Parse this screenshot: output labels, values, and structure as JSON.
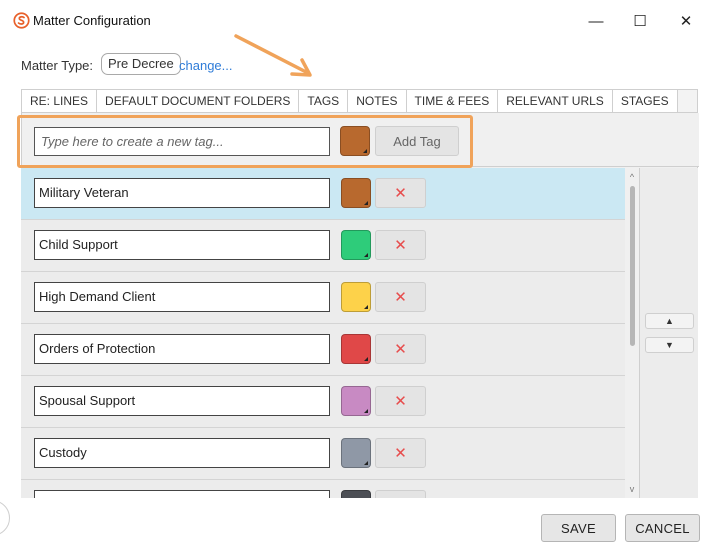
{
  "window": {
    "title": "Matter Configuration",
    "min_glyph": "—",
    "max_glyph": "☐",
    "close_glyph": "✕"
  },
  "matter_type": {
    "label": "Matter Type:",
    "value": "Pre Decree",
    "change_link": "change..."
  },
  "tabs": [
    {
      "label": "RE: LINES"
    },
    {
      "label": "DEFAULT DOCUMENT FOLDERS"
    },
    {
      "label": "TAGS",
      "active": true
    },
    {
      "label": "NOTES"
    },
    {
      "label": "TIME & FEES"
    },
    {
      "label": "RELEVANT URLS"
    },
    {
      "label": "STAGES"
    }
  ],
  "new_tag": {
    "placeholder": "Type here to create a new tag...",
    "color": "#b8692e",
    "add_label": "Add Tag"
  },
  "tags": [
    {
      "name": "Military Veteran",
      "color": "#b8692e",
      "selected": true
    },
    {
      "name": "Child Support",
      "color": "#2ecc7a"
    },
    {
      "name": "High Demand Client",
      "color": "#fdd24a"
    },
    {
      "name": "Orders of Protection",
      "color": "#e04848"
    },
    {
      "name": "Spousal Support",
      "color": "#c88ac3"
    },
    {
      "name": "Custody",
      "color": "#8f98a6"
    },
    {
      "name": "",
      "color": "#4c4f55"
    }
  ],
  "delete_glyph": "✕",
  "reorder": {
    "up": "▲",
    "down": "▼"
  },
  "scroll": {
    "up": "^",
    "down": "v"
  },
  "footer": {
    "save_label": "SAVE",
    "cancel_label": "CANCEL"
  },
  "colors": {
    "highlight": "#f0a35a",
    "link": "#2f7cd8",
    "selected_row": "#cbe8f3"
  }
}
